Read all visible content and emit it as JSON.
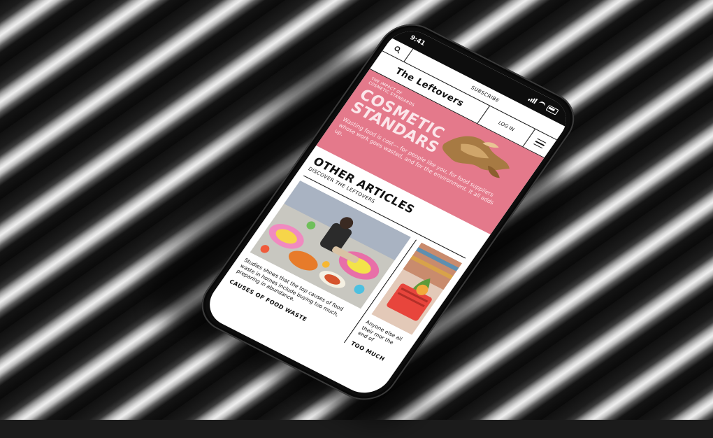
{
  "status": {
    "time": "9:41"
  },
  "nav": {
    "subscribe_label": "SUBSCRIBE",
    "login_label": "LOG IN",
    "brand": "The Leftovers"
  },
  "hero": {
    "kicker_line1": "THE IMPACT OF",
    "kicker_line2": "COSMETIC STANDARDS",
    "title_line1": "COSMETIC",
    "title_line2": "STANDARS",
    "text": "Wasting food is cost--- for people like you, for food suppliers whose work goes wasted, and for the environment. It all adds up.",
    "bg_color": "#e4798b"
  },
  "section": {
    "title": "OTHER ARTICLES",
    "subtitle": "DISCOVER THE LEFTOVERS"
  },
  "articles": [
    {
      "text": "Studies shows that the top causes of food waste in homes include buying too much, preparing in abundance.",
      "tag": "CAUSES OF FOOD WASTE"
    },
    {
      "text": "Anyone else all their mor the end of",
      "tag": "TOO MUCH"
    }
  ]
}
